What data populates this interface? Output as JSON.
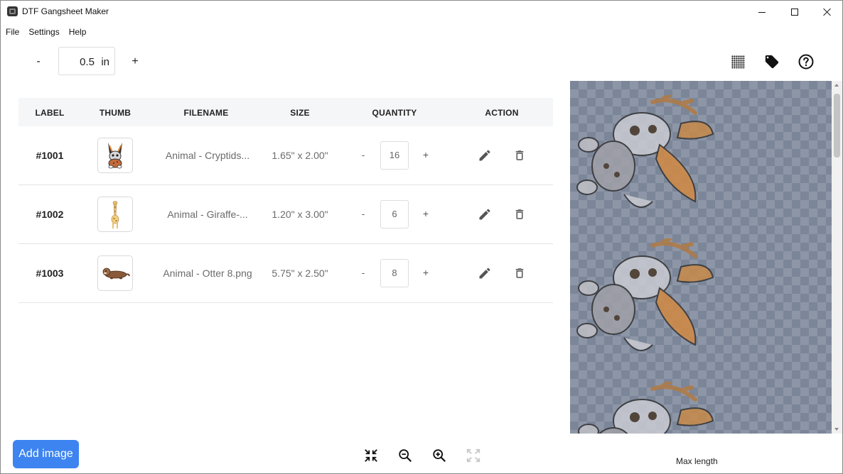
{
  "window": {
    "title": "DTF Gangsheet Maker",
    "icon": "app-icon"
  },
  "menu": [
    "File",
    "Settings",
    "Help"
  ],
  "toolbar": {
    "minus": "-",
    "plus": "+",
    "size_value": "0.5",
    "size_unit": "in",
    "icons": [
      "grid-icon",
      "tag-icon",
      "help-icon"
    ]
  },
  "table": {
    "headers": {
      "label": "LABEL",
      "thumb": "THUMB",
      "filename": "FILENAME",
      "size": "SIZE",
      "quantity": "QUANTITY",
      "action": "ACTION"
    },
    "rows": [
      {
        "label": "#1001",
        "filename": "Animal - Cryptids...",
        "size": "1.65\" x 2.00\"",
        "quantity": "16",
        "minus": "-",
        "plus": "+",
        "thumb": "jackalope-thumb"
      },
      {
        "label": "#1002",
        "filename": "Animal - Giraffe-...",
        "size": "1.20\" x 3.00\"",
        "quantity": "6",
        "minus": "-",
        "plus": "+",
        "thumb": "giraffe-thumb"
      },
      {
        "label": "#1003",
        "filename": "Animal - Otter 8.png",
        "size": "5.75\" x 2.50\"",
        "quantity": "8",
        "minus": "-",
        "plus": "+",
        "thumb": "otter-thumb"
      }
    ]
  },
  "preview": {
    "max_length_label": "Max length"
  },
  "bottom": {
    "add_image_label": "Add image",
    "icons": [
      "collapse-icon",
      "zoom-out-icon",
      "zoom-in-icon",
      "expand-icon"
    ]
  },
  "colors": {
    "accent": "#3d84f0",
    "preview_bg": "#7c8699",
    "header_bg": "#f5f6f8"
  }
}
